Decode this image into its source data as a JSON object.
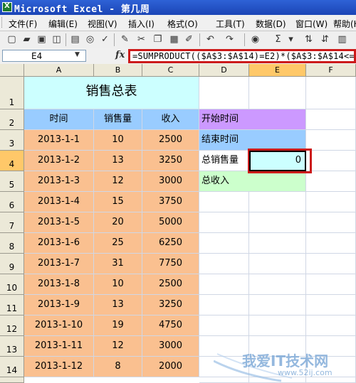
{
  "window": {
    "title": "Microsoft Excel - 第几周"
  },
  "menu": [
    "文件(F)",
    "编辑(E)",
    "视图(V)",
    "插入(I)",
    "格式(O)",
    "工具(T)",
    "数据(D)",
    "窗口(W)",
    "帮助(H)"
  ],
  "toolbar": [
    "new-icon",
    "open-icon",
    "save-icon",
    "permission-icon",
    "print-icon",
    "print-preview-icon",
    "spelling-icon",
    "research-icon",
    "cut-icon",
    "copy-icon",
    "paste-icon",
    "format-painter-icon",
    "undo-icon",
    "redo-icon",
    "hyperlink-icon",
    "autosum-icon",
    "sort-ascending-icon",
    "sort-descending-icon",
    "chart-icon"
  ],
  "formula_bar": {
    "name_box": "E4",
    "fx": "fx",
    "formula": "=SUMPRODUCT(($A$3:$A$14)=E2)*($A$3:$A$14<="
  },
  "columns": [
    "A",
    "B",
    "C",
    "D",
    "E",
    "F"
  ],
  "active_cell": "E4",
  "sheet": {
    "title": "销售总表",
    "headers": [
      "时间",
      "销售量",
      "收入"
    ],
    "rows": [
      [
        "2013-1-1",
        "10",
        "2500"
      ],
      [
        "2013-1-2",
        "13",
        "3250"
      ],
      [
        "2013-1-3",
        "12",
        "3000"
      ],
      [
        "2013-1-4",
        "15",
        "3750"
      ],
      [
        "2013-1-5",
        "20",
        "5000"
      ],
      [
        "2013-1-6",
        "25",
        "6250"
      ],
      [
        "2013-1-7",
        "31",
        "7750"
      ],
      [
        "2013-1-8",
        "10",
        "2500"
      ],
      [
        "2013-1-9",
        "13",
        "3250"
      ],
      [
        "2013-1-10",
        "19",
        "4750"
      ],
      [
        "2013-1-11",
        "12",
        "3000"
      ],
      [
        "2013-1-12",
        "8",
        "2000"
      ]
    ],
    "side_labels": [
      "开始时间",
      "结束时间",
      "总销售量",
      "总收入"
    ],
    "e4_value": "0"
  },
  "watermark": {
    "text": "我爱IT技术网",
    "url": "www.52ij.com"
  },
  "colors": {
    "title_fill": "#ccffff",
    "header_fill": "#99ccff",
    "data_fill": "#fac090",
    "start_time_fill": "#cc99ff",
    "end_time_fill": "#99ccff",
    "total_income_fill": "#ccffcc",
    "highlight_border": "#cc1a1a"
  }
}
